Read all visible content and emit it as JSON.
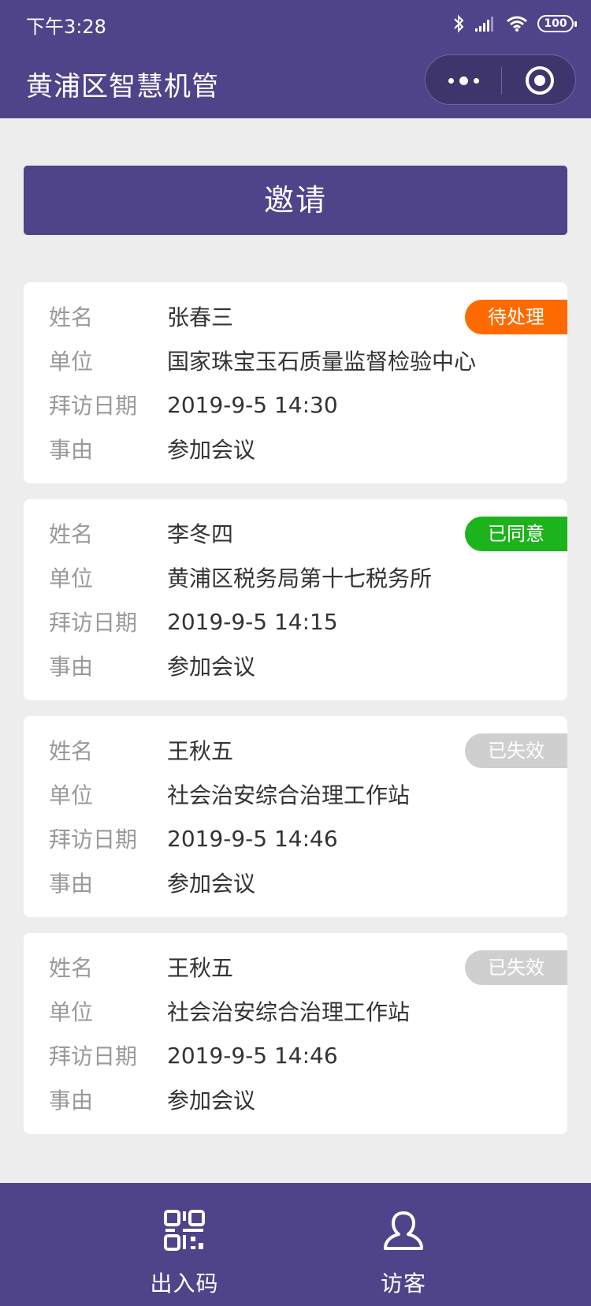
{
  "status_bar": {
    "time": "下午3:28",
    "battery": "100"
  },
  "nav": {
    "title": "黄浦区智慧机管"
  },
  "invite_button": "邀请",
  "labels": {
    "name": "姓名",
    "unit": "单位",
    "visit_date": "拜访日期",
    "reason": "事由"
  },
  "visitors": [
    {
      "name": "张春三",
      "unit": "国家珠宝玉石质量监督检验中心",
      "visit_date": "2019-9-5 14:30",
      "reason": "参加会议",
      "status": "待处理",
      "status_color": "#ff6a00"
    },
    {
      "name": "李冬四",
      "unit": "黄浦区税务局第十七税务所",
      "visit_date": "2019-9-5 14:15",
      "reason": "参加会议",
      "status": "已同意",
      "status_color": "#1db31d"
    },
    {
      "name": "王秋五",
      "unit": "社会治安综合治理工作站",
      "visit_date": "2019-9-5 14:46",
      "reason": "参加会议",
      "status": "已失效",
      "status_color": "#cfcfcf"
    },
    {
      "name": "王秋五",
      "unit": "社会治安综合治理工作站",
      "visit_date": "2019-9-5 14:46",
      "reason": "参加会议",
      "status": "已失效",
      "status_color": "#cfcfcf"
    }
  ],
  "tab_bar": {
    "tabs": [
      {
        "label": "出入码",
        "icon": "qr-code-icon"
      },
      {
        "label": "访客",
        "icon": "person-icon"
      }
    ]
  },
  "colors": {
    "brand": "#4f4489",
    "background": "#ededed"
  }
}
